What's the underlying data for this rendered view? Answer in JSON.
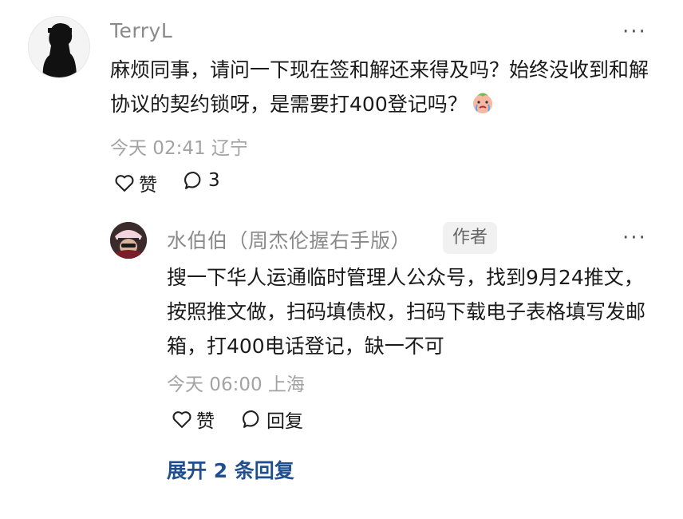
{
  "comment": {
    "username": "TerryL",
    "text": "麻烦同事，请问一下现在签和解还来得及吗？始终没收到和解协议的契约锁呀，是需要打400登记吗？",
    "emoji_icon": "crying-face-icon",
    "meta": "今天 02:41 辽宁",
    "like_label": "赞",
    "reply_count": "3"
  },
  "reply": {
    "username": "水伯伯（周杰伦握右手版）",
    "badge": "作者",
    "text": "搜一下华人运通临时管理人公众号，找到9月24推文，按照推文做，扫码填债权，扫码下载电子表格填写发邮箱，打400电话登记，缺一不可",
    "meta": "今天 06:00 上海",
    "like_label": "赞",
    "reply_label": "回复"
  },
  "expand_label": "展开 2 条回复",
  "more_glyph": "···",
  "colors": {
    "link": "#1f4f8f",
    "muted": "#a3a3a3",
    "username": "#8a8a8a"
  }
}
